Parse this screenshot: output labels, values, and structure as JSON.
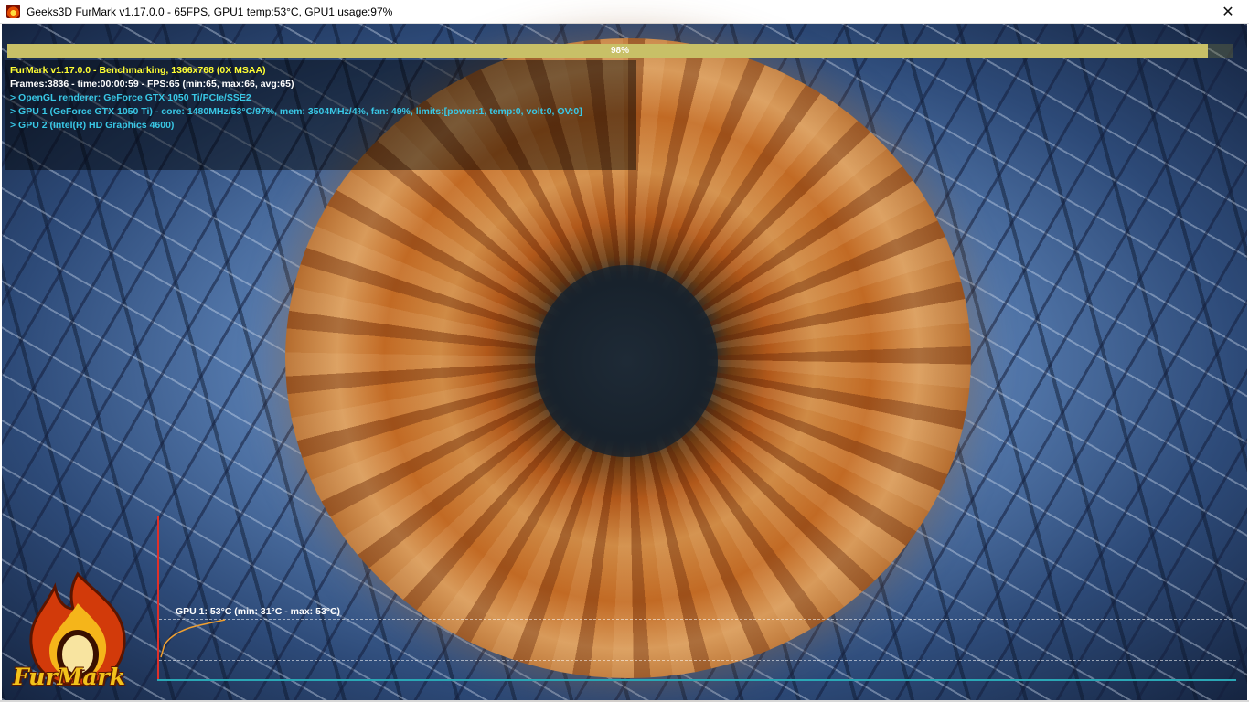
{
  "window": {
    "title": "Geeks3D FurMark v1.17.0.0 - 65FPS, GPU1 temp:53°C, GPU1 usage:97%",
    "close_glyph": "✕"
  },
  "progress": {
    "value_percent": 98,
    "label": "98%"
  },
  "info": {
    "header": "FurMark v1.17.0.0 - Benchmarking, 1366x768 (0X MSAA)",
    "stats": "Frames:3836 - time:00:00:59 - FPS:65 (min:65, max:66, avg:65)",
    "renderer": "> OpenGL renderer: GeForce GTX 1050 Ti/PCIe/SSE2",
    "gpu1": "> GPU 1 (GeForce GTX 1050 Ti) - core: 1480MHz/53°C/97%, mem: 3504MHz/4%, fan: 49%, limits:[power:1, temp:0, volt:0, OV:0]",
    "gpu2": "> GPU 2 (Intel(R) HD Graphics 4600)"
  },
  "graph": {
    "label": "GPU 1: 53°C (min: 31°C - max: 53°C)",
    "current_temp_c": 53,
    "min_temp_c": 31,
    "max_temp_c": 53
  },
  "logo": {
    "wordmark": "FurMark"
  },
  "colors": {
    "header_text": "#ffff33",
    "stats_text": "#ffffff",
    "gpu_text": "#39c8e6",
    "progress_fill": "#c8c067",
    "graph_axis_y": "#e0302a",
    "graph_axis_x": "#2aa7b5",
    "temp_curve": "#f0a030"
  }
}
